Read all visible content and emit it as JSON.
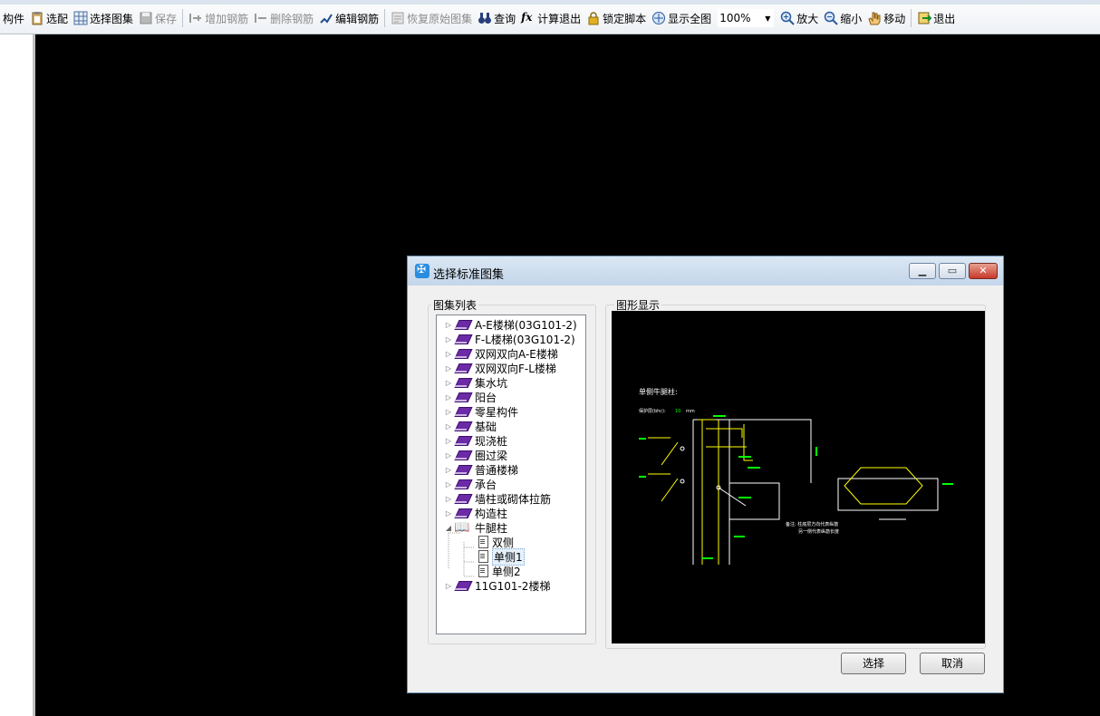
{
  "toolbar": {
    "items": [
      {
        "label": "构件",
        "icon": "component-icon",
        "enabled": true
      },
      {
        "label": "选配",
        "icon": "clipboard-icon",
        "enabled": true
      },
      {
        "label": "选择图集",
        "icon": "atlas-grid-icon",
        "enabled": true
      },
      {
        "label": "保存",
        "icon": "save-icon",
        "enabled": false
      },
      {
        "label": "增加钢筋",
        "icon": "add-rebar-icon",
        "enabled": false
      },
      {
        "label": "删除钢筋",
        "icon": "delete-rebar-icon",
        "enabled": false
      },
      {
        "label": "编辑钢筋",
        "icon": "edit-rebar-icon",
        "enabled": true
      },
      {
        "label": "恢复原始图集",
        "icon": "restore-icon",
        "enabled": false
      },
      {
        "label": "查询",
        "icon": "binoculars-icon",
        "enabled": true
      },
      {
        "label": "计算退出",
        "icon": "fx-icon",
        "enabled": true
      },
      {
        "label": "锁定脚本",
        "icon": "lock-icon",
        "enabled": true
      },
      {
        "label": "显示全图",
        "icon": "zoom-fit-icon",
        "enabled": true
      },
      {
        "label": "放大",
        "icon": "zoom-in-icon",
        "enabled": true
      },
      {
        "label": "缩小",
        "icon": "zoom-out-icon",
        "enabled": true
      },
      {
        "label": "移动",
        "icon": "pan-hand-icon",
        "enabled": true
      },
      {
        "label": "退出",
        "icon": "exit-icon",
        "enabled": true
      }
    ],
    "zoom_value": "100%"
  },
  "dialog": {
    "title": "选择标准图集",
    "tree_group_label": "图集列表",
    "preview_group_label": "图形显示",
    "select_button": "选择",
    "cancel_button": "取消",
    "tree": [
      {
        "label": "A-E楼梯(03G101-2)",
        "level": 0,
        "type": "book",
        "expanded": false
      },
      {
        "label": "F-L楼梯(03G101-2)",
        "level": 0,
        "type": "book",
        "expanded": false
      },
      {
        "label": "双网双向A-E楼梯",
        "level": 0,
        "type": "book",
        "expanded": false
      },
      {
        "label": "双网双向F-L楼梯",
        "level": 0,
        "type": "book",
        "expanded": false
      },
      {
        "label": "集水坑",
        "level": 0,
        "type": "book",
        "expanded": false
      },
      {
        "label": "阳台",
        "level": 0,
        "type": "book",
        "expanded": false
      },
      {
        "label": "零星构件",
        "level": 0,
        "type": "book",
        "expanded": false
      },
      {
        "label": "基础",
        "level": 0,
        "type": "book",
        "expanded": false
      },
      {
        "label": "现浇桩",
        "level": 0,
        "type": "book",
        "expanded": false
      },
      {
        "label": "圈过梁",
        "level": 0,
        "type": "book",
        "expanded": false
      },
      {
        "label": "普通楼梯",
        "level": 0,
        "type": "book",
        "expanded": false
      },
      {
        "label": "承台",
        "level": 0,
        "type": "book",
        "expanded": false
      },
      {
        "label": "墙柱或砌体拉筋",
        "level": 0,
        "type": "book",
        "expanded": false
      },
      {
        "label": "构造柱",
        "level": 0,
        "type": "book",
        "expanded": false
      },
      {
        "label": "牛腿柱",
        "level": 0,
        "type": "openbook",
        "expanded": true
      },
      {
        "label": "双侧",
        "level": 1,
        "type": "doc"
      },
      {
        "label": "单侧1",
        "level": 1,
        "type": "doc",
        "selected": true
      },
      {
        "label": "单侧2",
        "level": 1,
        "type": "doc"
      },
      {
        "label": "11G101-2楼梯",
        "level": 0,
        "type": "book",
        "expanded": false
      }
    ],
    "drawing": {
      "title": "单侧牛腿柱:",
      "cover_label": "保护层(bhc):",
      "cover_value": "10",
      "cover_unit": "mm",
      "note_line1": "备注: 柱底层方向代表纵筋",
      "note_line2": "另一侧代表纵筋长度"
    }
  },
  "colors": {
    "cad_line": "#ffffff",
    "cad_yellow": "#ffff00",
    "cad_green": "#00ff00",
    "selection": "#e5f1fb"
  }
}
